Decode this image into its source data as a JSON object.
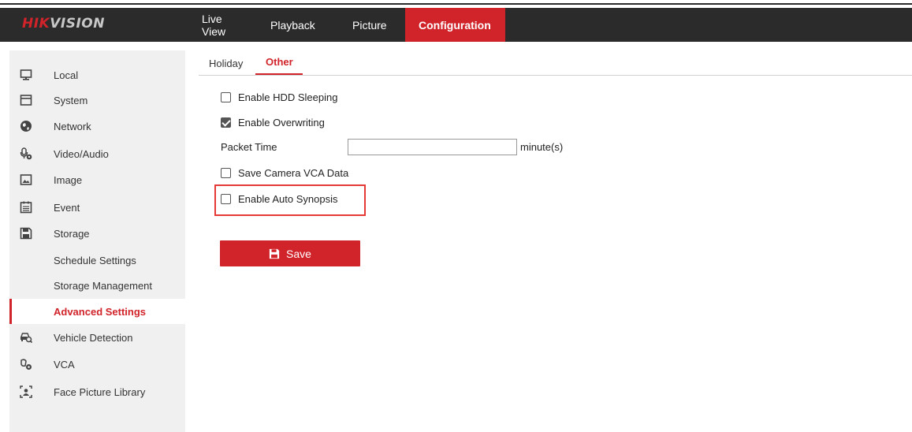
{
  "brand": {
    "prefix": "HIK",
    "suffix": "VISION"
  },
  "nav": [
    {
      "label": "Live View",
      "active": false
    },
    {
      "label": "Playback",
      "active": false
    },
    {
      "label": "Picture",
      "active": false
    },
    {
      "label": "Configuration",
      "active": true
    }
  ],
  "sidebar": {
    "items": [
      {
        "label": "Local",
        "icon": "monitor-icon"
      },
      {
        "label": "System",
        "icon": "system-icon"
      },
      {
        "label": "Network",
        "icon": "globe-icon"
      },
      {
        "label": "Video/Audio",
        "icon": "microphone-icon"
      },
      {
        "label": "Image",
        "icon": "image-icon"
      },
      {
        "label": "Event",
        "icon": "event-calendar-icon"
      },
      {
        "label": "Storage",
        "icon": "floppy-disk-icon"
      },
      {
        "label": "Schedule Settings",
        "icon": ""
      },
      {
        "label": "Storage Management",
        "icon": ""
      },
      {
        "label": "Advanced Settings",
        "icon": "",
        "active": true
      },
      {
        "label": "Vehicle Detection",
        "icon": "vehicle-search-icon"
      },
      {
        "label": "VCA",
        "icon": "vca-icon"
      },
      {
        "label": "Face Picture Library",
        "icon": "face-library-icon"
      }
    ]
  },
  "tabs": [
    {
      "label": "Holiday",
      "active": false
    },
    {
      "label": "Other",
      "active": true
    }
  ],
  "options": {
    "hdd_sleeping": {
      "label": "Enable HDD Sleeping",
      "checked": false
    },
    "overwriting": {
      "label": "Enable Overwriting",
      "checked": true
    },
    "packet_time": {
      "label": "Packet Time",
      "value": "",
      "unit": "minute(s)"
    },
    "save_vca": {
      "label": "Save Camera VCA Data",
      "checked": false
    },
    "auto_synopsis": {
      "label": "Enable Auto Synopsis",
      "checked": false
    }
  },
  "save": {
    "label": "Save"
  },
  "colors": {
    "accent": "#d1232a",
    "topbar": "#2b2b2b",
    "sidebar": "#f0f0f0",
    "highlight": "#e53935"
  }
}
